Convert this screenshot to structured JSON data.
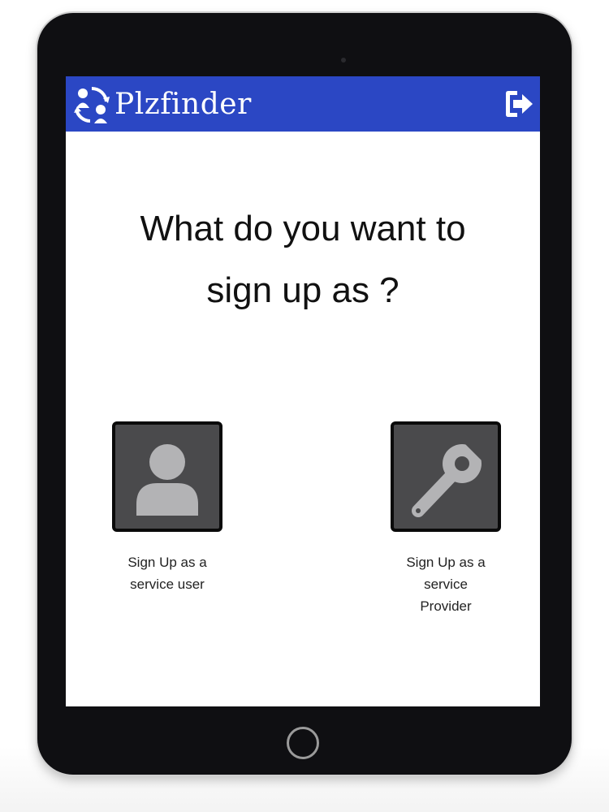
{
  "app": {
    "name": "Plzfinder",
    "brand_color": "#2b47c4"
  },
  "header": {
    "logo_icon": "people-cycle-icon",
    "logout_icon": "sign-out-icon"
  },
  "main": {
    "question_line1": "What do you want to",
    "question_line2": "sign up as ?"
  },
  "options": {
    "user": {
      "icon": "person-icon",
      "label_line1": "Sign Up as a",
      "label_line2": "service user"
    },
    "provider": {
      "icon": "wrench-icon",
      "label_line1": "Sign Up as a",
      "label_line2": "service",
      "label_line3": "Provider"
    }
  },
  "colors": {
    "tile_bg": "#4a4a4c",
    "icon_fill": "#b3b3b5",
    "text": "#111111"
  }
}
